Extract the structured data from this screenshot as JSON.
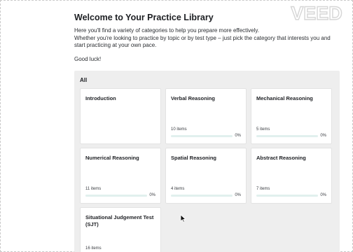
{
  "page": {
    "title": "Welcome to Your Practice Library",
    "intro_line_1": "Here you'll find a variety of categories to help you prepare more effectively.",
    "intro_line_2": "Whether you're looking to practice by topic or by test type – just pick the category that interests you and start practicing at your own pace.",
    "intro_line_3": "Good luck!"
  },
  "watermark": {
    "text": "VEED"
  },
  "library": {
    "filter_label": "All",
    "cards": [
      {
        "title": "Introduction",
        "count": "",
        "percent": "",
        "progress": null
      },
      {
        "title": "Verbal Reasoning",
        "count": "10 items",
        "percent": "0%",
        "progress": 0
      },
      {
        "title": "Mechanical Reasoning",
        "count": "5 items",
        "percent": "0%",
        "progress": 0
      },
      {
        "title": "Numerical Reasoning",
        "count": "11 items",
        "percent": "0%",
        "progress": 0
      },
      {
        "title": "Spatial Reasoning",
        "count": "4 items",
        "percent": "0%",
        "progress": 0
      },
      {
        "title": "Abstract Reasoning",
        "count": "7 items",
        "percent": "0%",
        "progress": 0
      },
      {
        "title": "Situational Judgement Test (SJT)",
        "count": "16 items",
        "percent": "",
        "progress": null
      }
    ]
  },
  "icons": {
    "cursor": "mouse-pointer-icon"
  },
  "colors": {
    "panel_bg": "#eeeeee",
    "card_bg": "#ffffff",
    "progress_track": "#e1f0ee",
    "progress_fill": "#3aa79a"
  }
}
